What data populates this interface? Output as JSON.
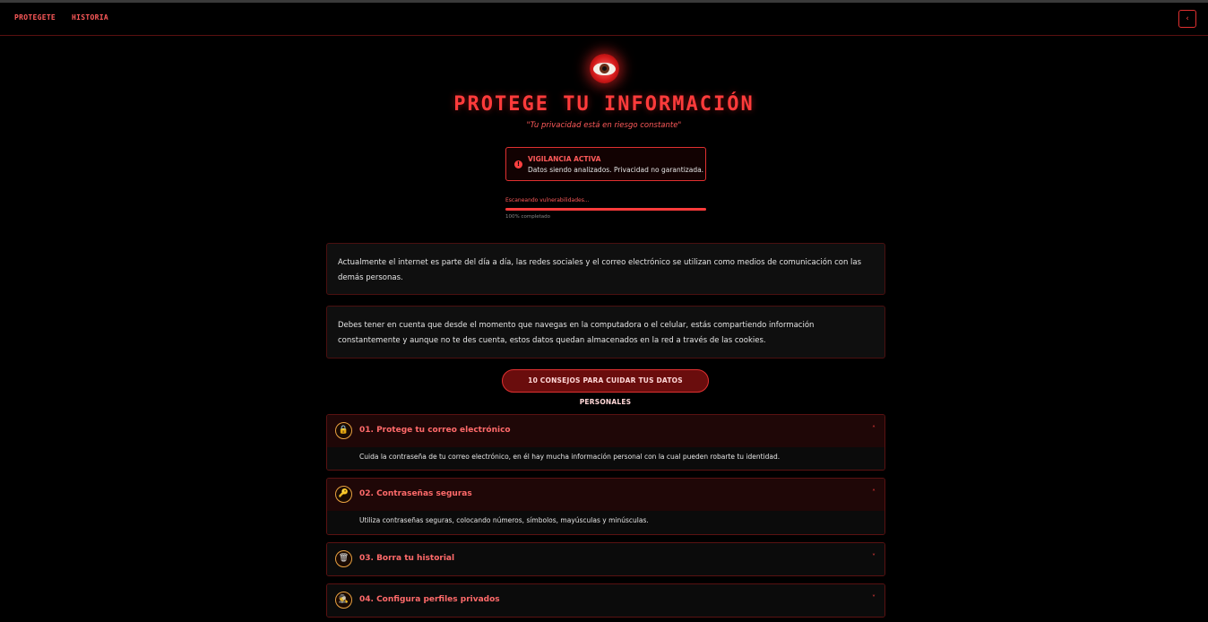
{
  "nav": {
    "links": [
      "PROTEGETE",
      "HISTORIA"
    ],
    "back_icon": "chevron-left-icon"
  },
  "hero": {
    "icon": "eye-icon",
    "title": "PROTEGE TU INFORMACIÓN",
    "subtitle": "\"Tu privacidad está en riesgo constante\""
  },
  "alert": {
    "icon": "alert-circle-icon",
    "title": "VIGILANCIA ACTIVA",
    "text": "Datos siendo analizados. Privacidad no garantizada."
  },
  "scan": {
    "label": "Escaneando vulnerabilidades...",
    "progress_percent": 100,
    "status": "100% completado"
  },
  "paragraphs": [
    "Actualmente el internet es parte del día a día, las redes sociales y el correo electrónico se utilizan como medios de comunicación con las demás personas.",
    "Debes tener en cuenta que desde el momento que navegas en la computadora o el celular, estás compartiendo información constantemente y aunque no te des cuenta, estos datos quedan almacenados en la red a través de las cookies."
  ],
  "tips_button": "10 CONSEJOS PARA CUIDAR TUS DATOS PERSONALES",
  "tips": [
    {
      "icon": "lock-icon",
      "glyph": "🔒",
      "title": "01. Protege tu correo electrónico",
      "body": "Cuida la contraseña de tu correo electrónico, en él hay mucha información personal con la cual pueden robarte tu identidad.",
      "expanded": true,
      "chevron": "˄"
    },
    {
      "icon": "key-icon",
      "glyph": "🔑",
      "title": "02. Contraseñas seguras",
      "body": "Utiliza contraseñas seguras, colocando números, símbolos, mayúsculas y minúsculas.",
      "expanded": true,
      "chevron": "˄"
    },
    {
      "icon": "trash-icon",
      "glyph": "🗑",
      "title": "03. Borra tu historial",
      "body": "",
      "expanded": false,
      "chevron": "˅"
    },
    {
      "icon": "private-profile-icon",
      "glyph": "🕵",
      "title": "04. Configura perfiles privados",
      "body": "",
      "expanded": false,
      "chevron": "˅"
    }
  ]
}
